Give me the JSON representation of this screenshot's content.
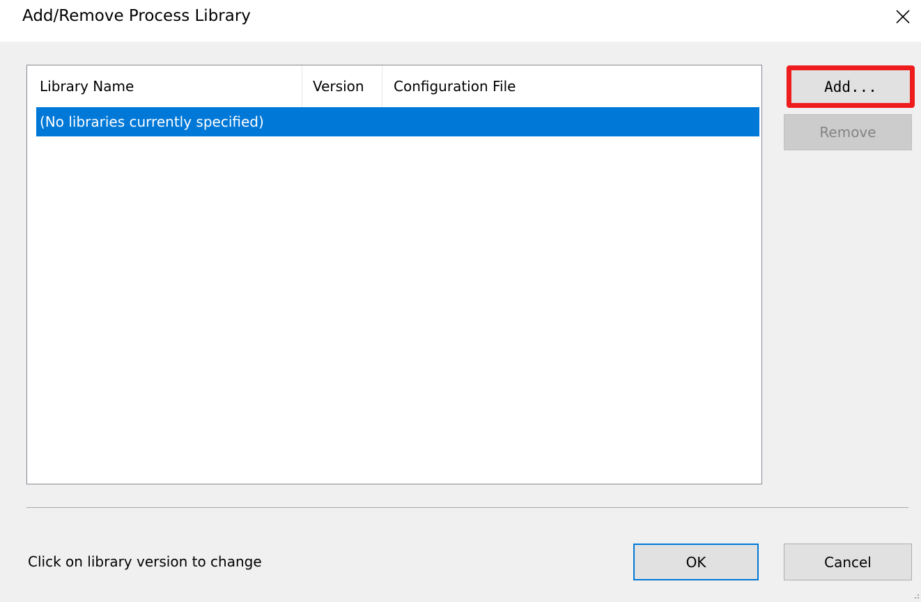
{
  "window": {
    "title": "Add/Remove Process Library",
    "close_icon": "close-icon"
  },
  "list": {
    "columns": [
      "Library Name",
      "Version",
      "Configuration File"
    ],
    "rows": [
      "(No libraries currently specified)"
    ],
    "selected_row_color": "#0078d7"
  },
  "buttons": {
    "add": "Add...",
    "remove": "Remove",
    "ok": "OK",
    "cancel": "Cancel"
  },
  "status": {
    "hint": "Click on library version to change"
  },
  "colors": {
    "highlight_border": "#ee1c1c",
    "default_button_border": "#0078d7",
    "dialog_background": "#f0f0f0"
  }
}
